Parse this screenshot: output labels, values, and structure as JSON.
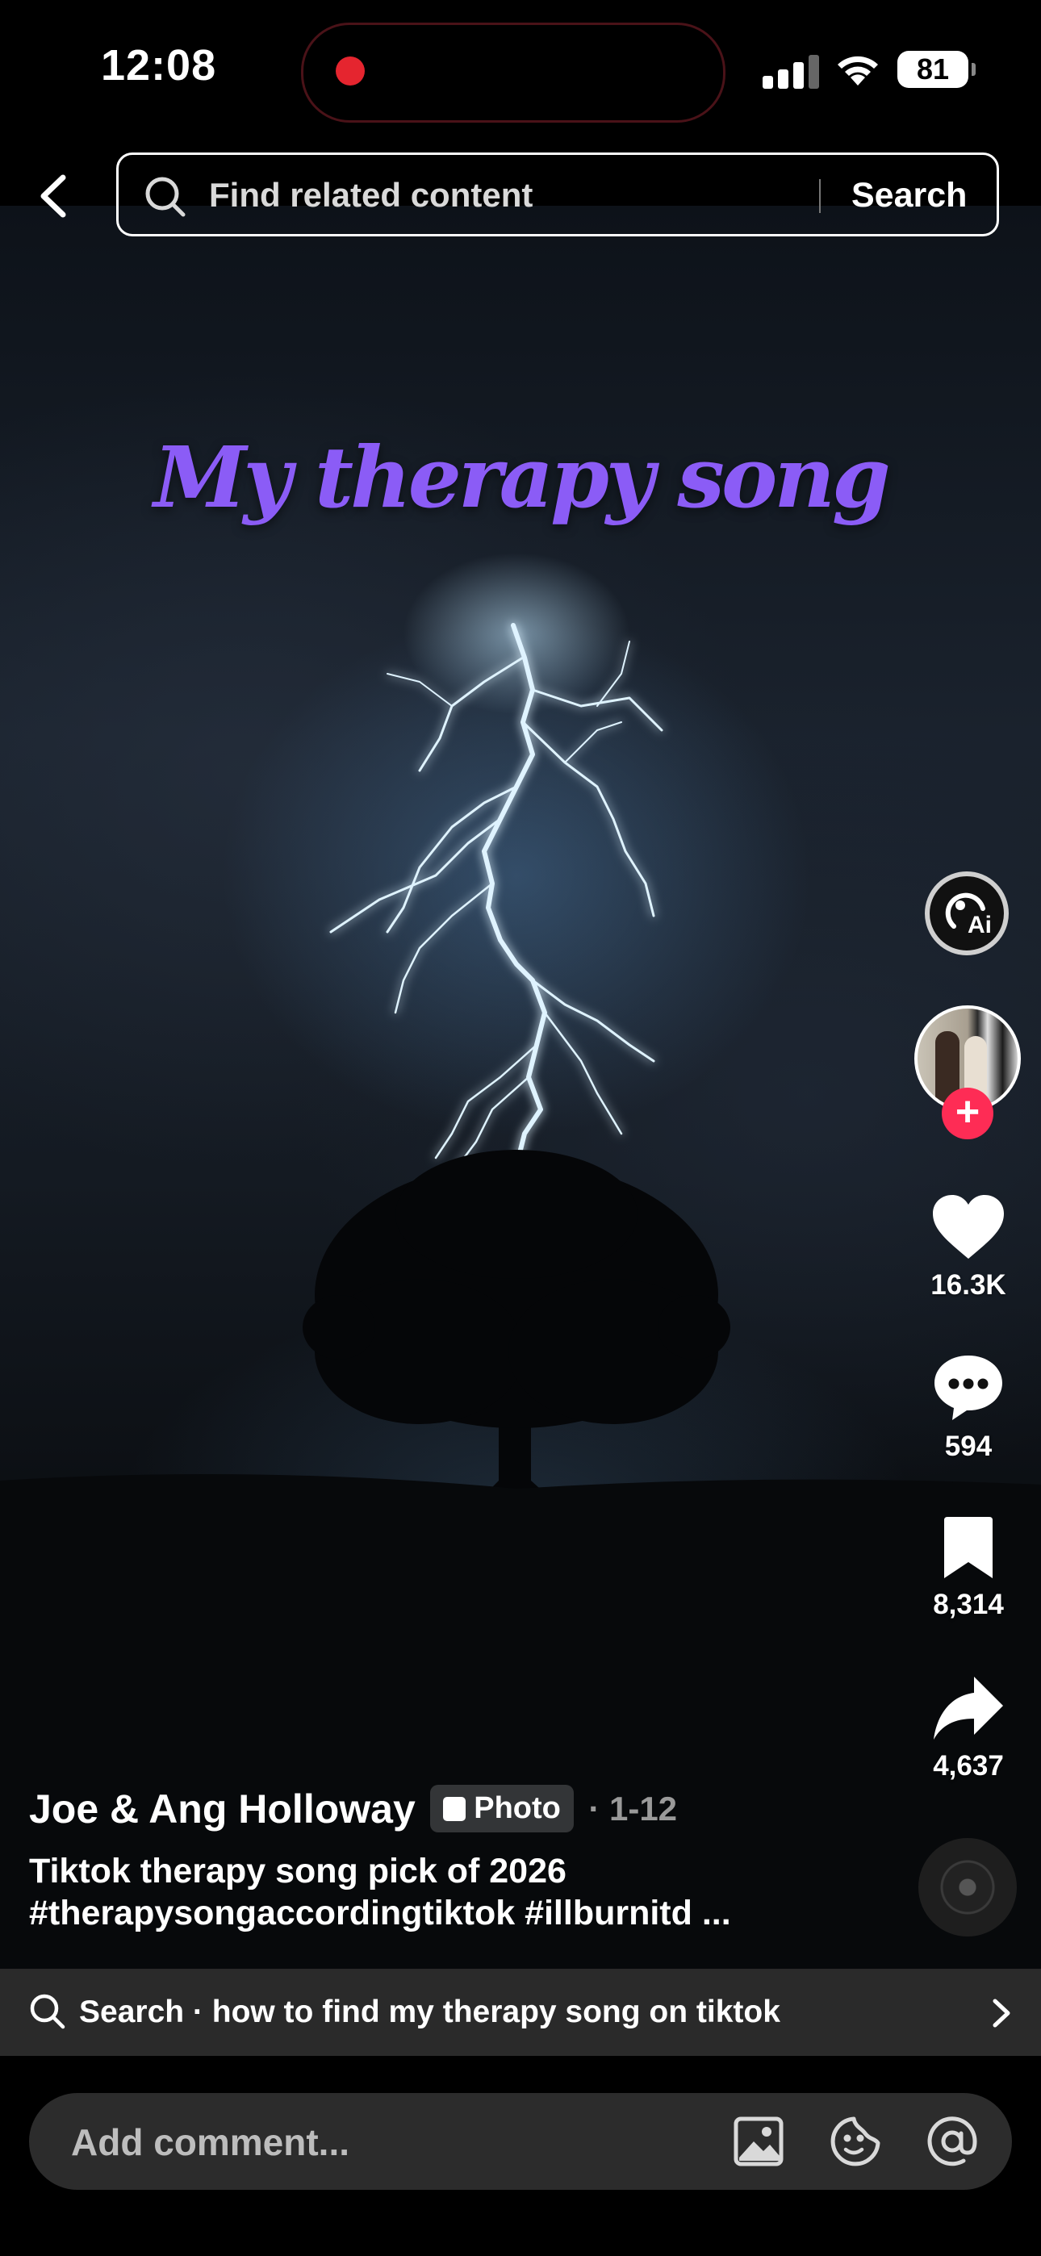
{
  "status_bar": {
    "time": "12:08",
    "battery": "81"
  },
  "search": {
    "placeholder": "Find related content",
    "button_label": "Search"
  },
  "video": {
    "overlay_text": "My therapy song"
  },
  "actions": {
    "likes": "16.3K",
    "comments": "594",
    "saves": "8,314",
    "shares": "4,637",
    "ai_label": "Ai"
  },
  "post": {
    "author": "Joe & Ang Holloway",
    "type_badge": "Photo",
    "date": "· 1-12",
    "caption_line1": "Tiktok therapy song pick of 2026",
    "caption_line2": "#therapysongaccordingtiktok #illburnitd ..."
  },
  "suggestion": {
    "text": "Search · how to find my therapy song on tiktok"
  },
  "comment": {
    "placeholder": "Add comment..."
  },
  "colors": {
    "accent": "#fe2c55",
    "overlay_title": "#8b5cf6",
    "record_dot": "#e5252f"
  }
}
